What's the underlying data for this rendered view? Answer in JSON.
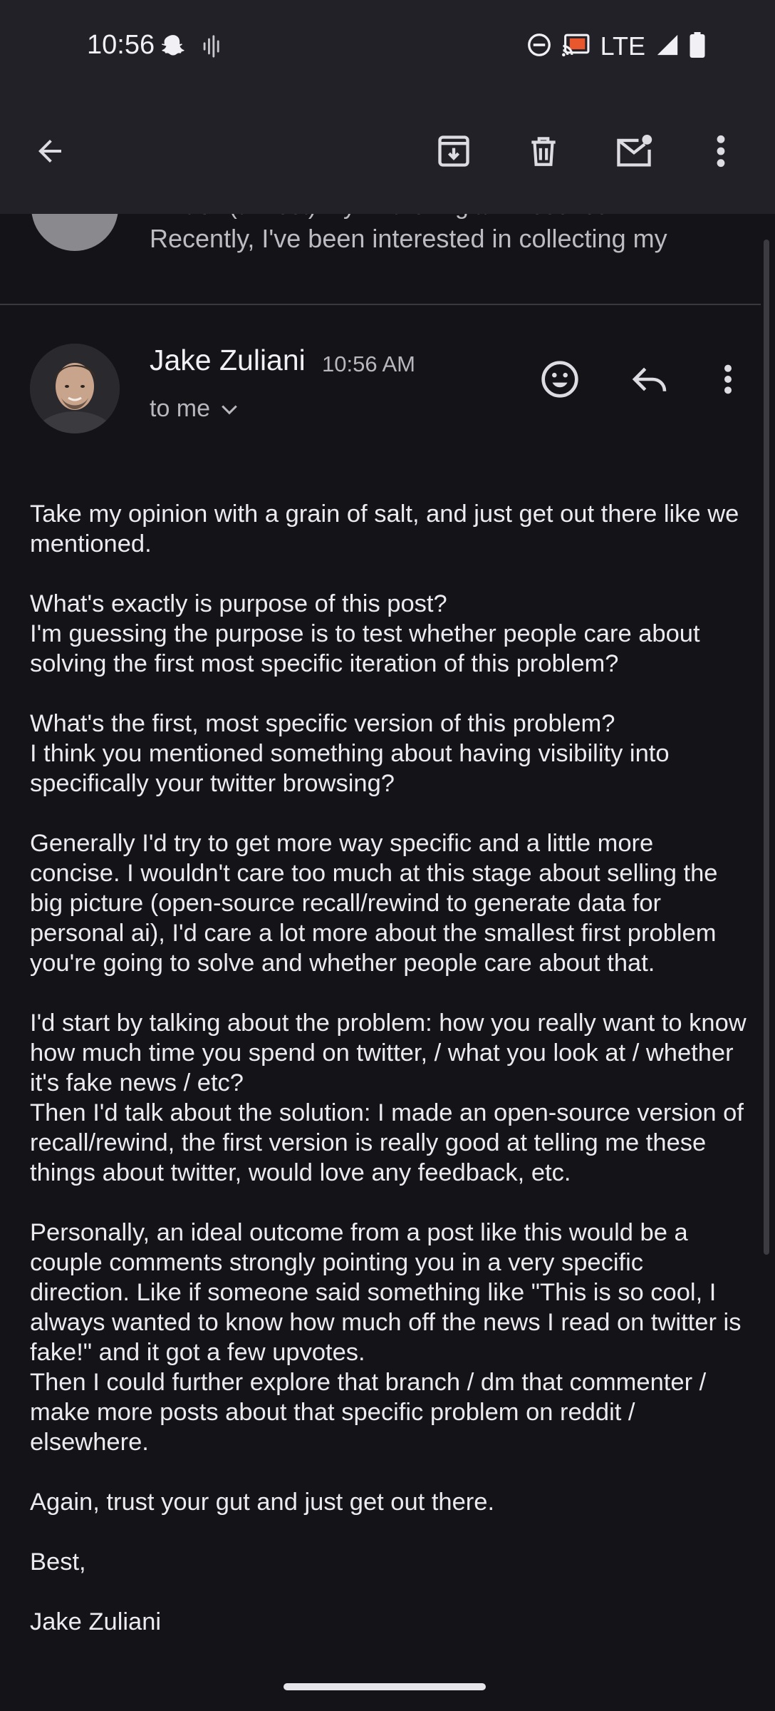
{
  "status_bar": {
    "time": "10:56",
    "network": "LTE",
    "icons": [
      "snapchat-ghost-icon",
      "voice-waveform-icon",
      "do-not-disturb-icon",
      "cast-icon",
      "signal-icon",
      "battery-icon"
    ]
  },
  "toolbar": {
    "icons": [
      "back-arrow-icon",
      "archive-icon",
      "delete-icon",
      "mark-unread-icon",
      "more-vert-icon"
    ]
  },
  "previous_message": {
    "subject": "I Track (almost) my Entire Digital Presence",
    "snippet": "Recently, I've been interested in collecting my"
  },
  "message": {
    "sender": "Jake Zuliani",
    "time": "10:56 AM",
    "recipient": "to me",
    "paragraphs": [
      "Take my opinion with a grain of salt, and just get out there like we mentioned.",
      "What's exactly is purpose of this post?\nI'm guessing the purpose is to test whether people care about solving the first most specific iteration of this problem?",
      "What's the first, most specific version of this problem?\nI think you mentioned something about having visibility into specifically your twitter browsing?",
      "Generally I'd try to get more way specific and a little more concise. I wouldn't care too much at this stage about selling the big picture (open-source recall/rewind to generate data for personal ai), I'd care a lot more about the smallest first problem you're going to solve and whether people care about that.",
      "I'd start by talking about the problem: how you really want to know how much time you spend on twitter, / what you look at / whether it's fake news / etc?\nThen I'd talk about the solution: I made an open-source version of recall/rewind, the first version is really good at telling me these things about twitter, would love any feedback, etc.",
      "Personally, an ideal outcome from a post like this would be a couple comments strongly pointing you in a very specific direction. Like if someone said something like \"This is so cool, I always wanted to know how much off the news I read on twitter is fake!\" and it got a few upvotes.\nThen I could further explore that branch / dm that commenter / make more posts about that specific problem on reddit / elsewhere.",
      "Again, trust your gut and just get out there.",
      "Best,",
      "Jake Zuliani"
    ]
  },
  "colors": {
    "background": "#141318",
    "toolbar": "#212127",
    "text": "#ecebef",
    "secondary_text": "#b8b7be"
  }
}
